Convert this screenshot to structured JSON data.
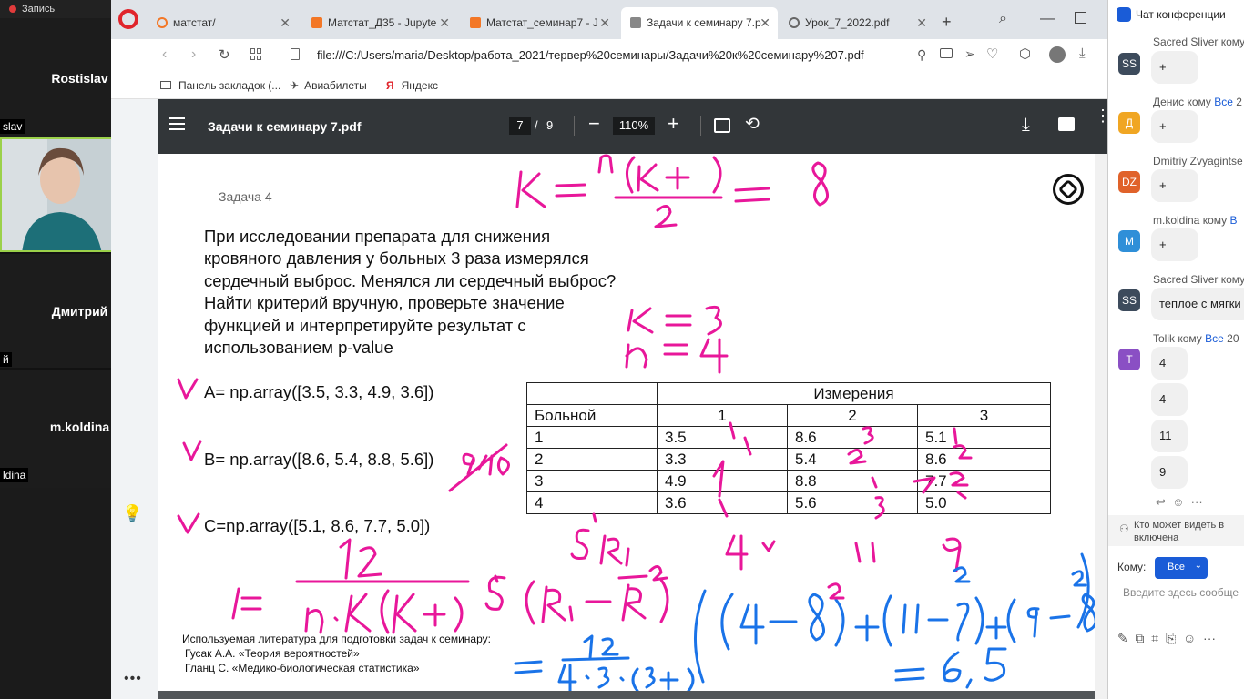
{
  "recording": {
    "label": "Запись"
  },
  "participants": {
    "tiles": [
      {
        "name": "Rostislav",
        "cut_label": "slav"
      },
      {
        "name": "Дмитрий",
        "cut_label": "й"
      },
      {
        "name": "m.koldina",
        "cut_label": "ldina"
      }
    ]
  },
  "browser": {
    "tabs": [
      {
        "title": "матстат/"
      },
      {
        "title": "Матстат_Д35 - Jupyte"
      },
      {
        "title": "Матстат_семинар7 - J"
      },
      {
        "title": "Задачи к семинару 7.p"
      },
      {
        "title": "Урок_7_2022.pdf"
      }
    ],
    "url": "file:///C:/Users/maria/Desktop/работа_2021/тервер%20семинары/Задачи%20к%20семинару%207.pdf",
    "bookmarks": [
      {
        "label": "Панель закладок (..."
      },
      {
        "label": "Авиабилеты"
      },
      {
        "label": "Яндекс"
      }
    ]
  },
  "pdf": {
    "title": "Задачи к семинару 7.pdf",
    "page_current": "7",
    "page_total": "9",
    "page_sep": "/",
    "zoom": "110%",
    "task_header": "Задача 4",
    "task_lines": [
      "При исследовании препарата для снижения",
      "кровяного давления у больных 3 раза измерялся",
      "сердечный выброс. Менялся ли сердечный выброс?",
      "Найти критерий вручную, проверьте значение",
      "функцией и интерпретируйте результат с",
      "использованием p-value"
    ],
    "arrays": [
      "A= np.array([3.5, 3.3, 4.9, 3.6])",
      "B= np.array([8.6, 5.4, 8.8, 5.6])",
      "C=np.array([5.1, 8.6, 7.7, 5.0])"
    ],
    "table": {
      "group_header": "Измерения",
      "row_header": "Больной",
      "columns": [
        "1",
        "2",
        "3"
      ],
      "rows": [
        [
          "1",
          "3.5",
          "8.6",
          "5.1"
        ],
        [
          "2",
          "3.3",
          "5.4",
          "8.6"
        ],
        [
          "3",
          "4.9",
          "8.8",
          "7.7"
        ],
        [
          "4",
          "3.6",
          "5.6",
          "5.0"
        ]
      ]
    },
    "literature": [
      "Используемая литература для подготовки задач к семинару:",
      "Гусак А.А. «Теория вероятностей»",
      "Гланц С. «Медико-биологическая статистика»"
    ]
  },
  "chat": {
    "title": "Чат конференции",
    "messages": [
      {
        "sender": "Sacred Sliver кому",
        "avatar": "SS",
        "avatar_color": "#3d4b5c",
        "texts": [
          "+"
        ]
      },
      {
        "sender": "Денис кому",
        "to": "Все",
        "suffix": "2",
        "avatar": "Д",
        "avatar_color": "#f0a623",
        "texts": [
          "+"
        ]
      },
      {
        "sender": "Dmitriy Zvyagintse",
        "avatar": "DZ",
        "avatar_color": "#e0622a",
        "texts": [
          "+"
        ]
      },
      {
        "sender": "m.koldina кому",
        "to": "В",
        "avatar": "M",
        "avatar_color": "#2f8fd8",
        "texts": [
          "+"
        ]
      },
      {
        "sender": "Sacred Sliver кому",
        "avatar": "SS",
        "avatar_color": "#3d4b5c",
        "texts": [
          "теплое с мягки"
        ]
      },
      {
        "sender": "Tolik кому",
        "to": "Все",
        "suffix": "20",
        "avatar": "T",
        "avatar_color": "#8a4fc4",
        "texts": [
          "4",
          "4",
          "11",
          "9"
        ]
      }
    ],
    "privacy_note_1": "Кто может видеть в",
    "privacy_note_2": "включена",
    "to_label": "Кому:",
    "to_value": "Все",
    "input_placeholder": "Введите здесь сообще"
  },
  "colors": {
    "ink_pink": "#e8179a",
    "ink_blue": "#1a73e8",
    "pdf_toolbar": "#323639",
    "zoom_accent": "#1a5cd7"
  }
}
